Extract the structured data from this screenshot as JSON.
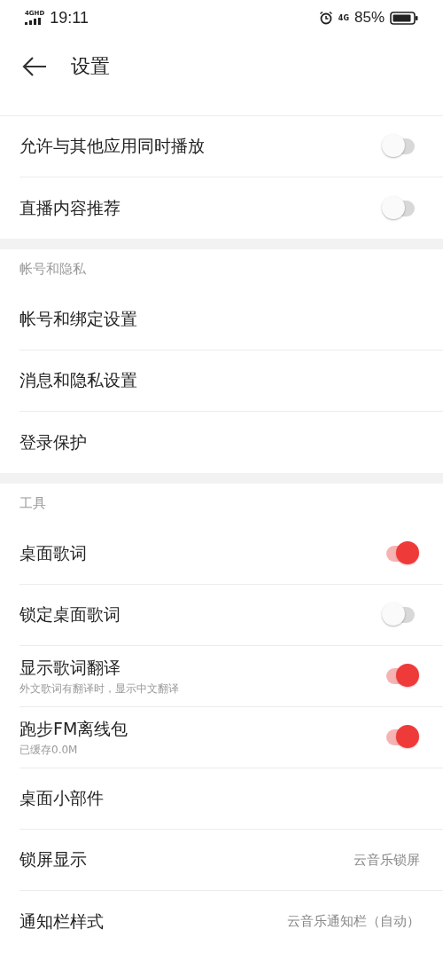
{
  "status_bar": {
    "network_label": "4GHD",
    "time": "19:11",
    "data_label": "4G",
    "battery": "85%"
  },
  "header": {
    "title": "设置"
  },
  "sections": [
    {
      "items": [
        {
          "kind": "toggle",
          "label": "允许与其他应用同时播放",
          "on": false
        },
        {
          "kind": "toggle",
          "label": "直播内容推荐",
          "on": false
        }
      ]
    },
    {
      "title": "帐号和隐私",
      "items": [
        {
          "kind": "link",
          "label": "帐号和绑定设置"
        },
        {
          "kind": "link",
          "label": "消息和隐私设置"
        },
        {
          "kind": "link",
          "label": "登录保护"
        }
      ]
    },
    {
      "title": "工具",
      "items": [
        {
          "kind": "toggle",
          "label": "桌面歌词",
          "on": true
        },
        {
          "kind": "toggle",
          "label": "锁定桌面歌词",
          "on": false
        },
        {
          "kind": "toggle",
          "label": "显示歌词翻译",
          "subtitle": "外文歌词有翻译时，显示中文翻译",
          "on": true
        },
        {
          "kind": "toggle",
          "label": "跑步FM离线包",
          "subtitle": "已缓存0.0M",
          "on": true
        },
        {
          "kind": "link",
          "label": "桌面小部件"
        },
        {
          "kind": "value",
          "label": "锁屏显示",
          "value": "云音乐锁屏"
        },
        {
          "kind": "value",
          "label": "通知栏样式",
          "value": "云音乐通知栏（自动）"
        }
      ]
    }
  ]
}
